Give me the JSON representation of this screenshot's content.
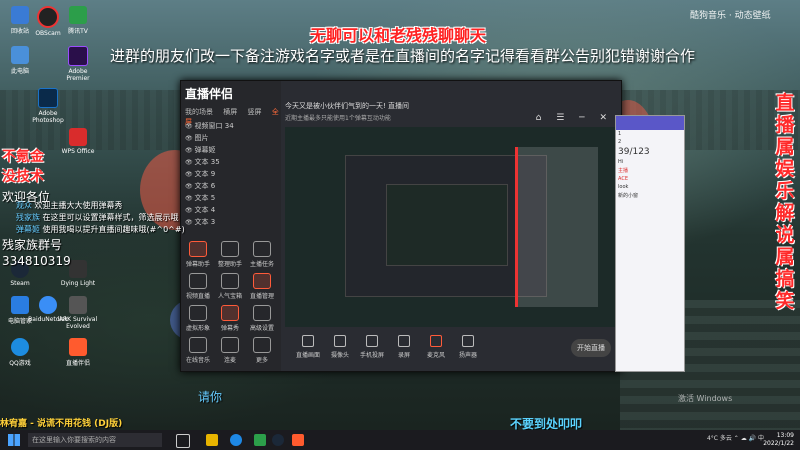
{
  "overlay": {
    "title_red": "无聊可以和老残残聊聊天",
    "banner": "进群的朋友们改一下备注游戏名字或者是在直播间的名字记得看看群公告别犯错谢谢合作",
    "vertical_text": "直播属娱乐解说属搞笑",
    "side_red_1": "不氪金",
    "side_red_2": "没技术",
    "side_white_1": "欢迎各位",
    "group_label": "残家族群号",
    "group_number": "334810319",
    "bottom_sub": "不要到处叩叩",
    "song": "林宥嘉 - 说谎不用花钱 (DJ版)",
    "top_right_logo": "酷狗音乐 · 动态壁纸",
    "watermark": "激活 Windows",
    "mid_label": "请你"
  },
  "chat_messages": [
    {
      "name": "观众",
      "text": "欢迎主播大大使用弹幕秀"
    },
    {
      "name": "残家族",
      "text": "在这里可以设置弹幕样式，筛选展示哦"
    },
    {
      "name": "弹幕姬",
      "text": "使用我喝以提升直播间趣味哦(#^0^#)"
    }
  ],
  "desktop_icons": [
    {
      "label": "回收站",
      "color": "#3a7bd5"
    },
    {
      "label": "OBScam",
      "color": "#222"
    },
    {
      "label": "腾讯TV",
      "color": "#2c9e4a"
    },
    {
      "label": "此电脑",
      "color": "#4a90d9"
    },
    {
      "label": "Adobe Premier",
      "color": "#9a4dff"
    },
    {
      "label": "Adobe Photoshop",
      "color": "#1a73c9"
    },
    {
      "label": "WPS Office",
      "color": "#d92c2c"
    },
    {
      "label": "Steam",
      "color": "#1b2838"
    },
    {
      "label": "Dying Light",
      "color": "#333"
    },
    {
      "label": "电脑管家",
      "color": "#2a7de1"
    },
    {
      "label": "BaiduNetdisk",
      "color": "#3a8ef6"
    },
    {
      "label": "ARK Survival Evolved",
      "color": "#555"
    },
    {
      "label": "QQ游戏",
      "color": "#1d8ce0"
    },
    {
      "label": "直播伴侣",
      "color": "#ff5b2e"
    }
  ],
  "app": {
    "logo": "直播伴侣",
    "tabs": [
      "我的场景",
      "横屏",
      "竖屏",
      "全屏"
    ],
    "active_tab": "全屏",
    "sources": [
      "视频窗口 34",
      "图片",
      "弹幕姬",
      "文本 35",
      "文本 9",
      "文本 6",
      "文本 5",
      "文本 4",
      "文本 3"
    ],
    "tools": [
      "弹幕助手",
      "整理助手",
      "主播任务",
      "视频直播",
      "人气宝箱",
      "直播管理",
      "虚拟形象",
      "弹幕秀",
      "高级设置",
      "在线音乐",
      "连麦",
      "更多"
    ],
    "top_title": "今天又是被小伙伴们气到的一天! 直播间",
    "notice": "近期主播最多只能使用1个弹幕互动功能",
    "bottom_buttons": [
      "直播画面",
      "摄像头",
      "手机投屏",
      "录屏",
      "麦克风",
      "扬声器"
    ],
    "go_live": "开始直播"
  },
  "chat_window": {
    "lines": [
      "1",
      "2",
      "39/123",
      "Hi",
      "主播",
      "ACE",
      "look",
      "新的小窗"
    ]
  },
  "taskbar": {
    "search_placeholder": "在这里输入你要搜索的内容",
    "weather": "4°C 多云",
    "time": "13:09",
    "date": "2022/1/22"
  }
}
